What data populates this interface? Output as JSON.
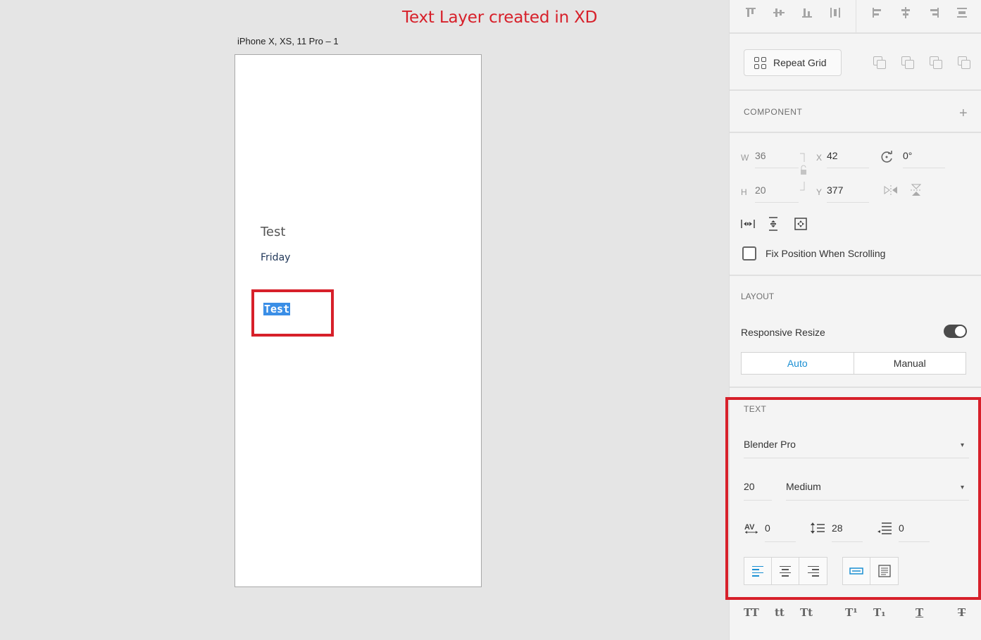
{
  "annotation": {
    "title": "Text Layer created in XD"
  },
  "canvas": {
    "artboard_label": "iPhone X, XS, 11 Pro – 1",
    "texts": {
      "test": "Test",
      "friday": "Friday",
      "selected": "Test"
    }
  },
  "panel": {
    "repeat_grid_label": "Repeat Grid",
    "component_label": "COMPONENT",
    "transform": {
      "w_label": "W",
      "w": "36",
      "h_label": "H",
      "h": "20",
      "x_label": "X",
      "x": "42",
      "y_label": "Y",
      "y": "377",
      "rotation": "0°"
    },
    "fix_position_label": "Fix Position When Scrolling",
    "layout": {
      "label": "LAYOUT",
      "responsive_label": "Responsive Resize",
      "options": [
        "Auto",
        "Manual"
      ],
      "active_option": "Auto"
    },
    "text": {
      "label": "TEXT",
      "font_family": "Blender Pro",
      "font_size": "20",
      "font_weight": "Medium",
      "char_spacing": "0",
      "line_spacing": "28",
      "paragraph_spacing": "0"
    },
    "type_styles": [
      "TT",
      "tt",
      "Tt",
      "T¹",
      "T₁",
      "T",
      "T"
    ]
  },
  "colors": {
    "accent": "#1a8fd3",
    "annotation": "#d7202a"
  }
}
